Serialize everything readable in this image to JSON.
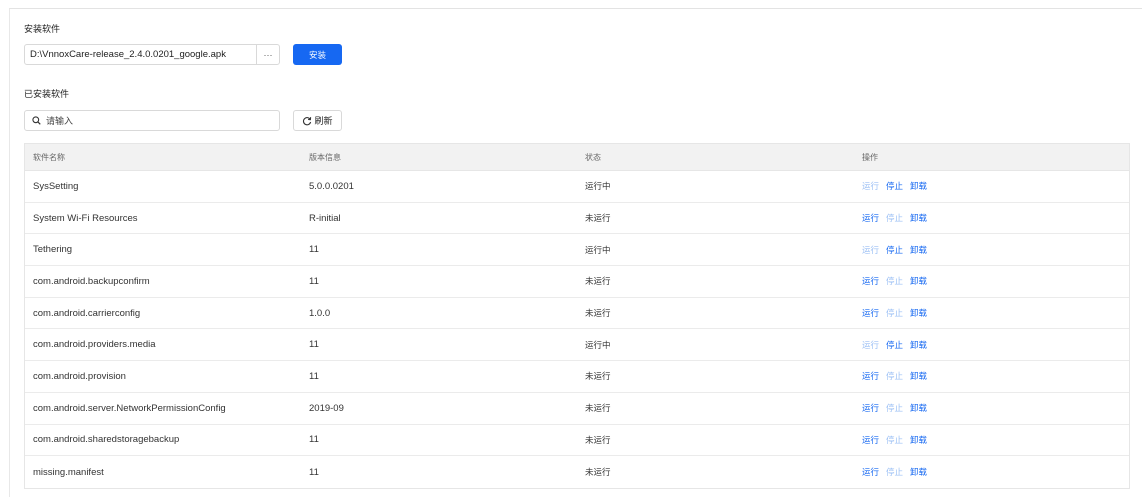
{
  "install": {
    "section_title": "安装软件",
    "file_path": "D:\\VnnoxCare-release_2.4.0.0201_google.apk",
    "browse_label": "···",
    "install_label": "安装"
  },
  "installed": {
    "section_title": "已安装软件",
    "search_placeholder": "请输入",
    "refresh_label": "刷新"
  },
  "table": {
    "headers": [
      "软件名称",
      "版本信息",
      "状态",
      "操作"
    ],
    "rows": [
      {
        "name": "SysSetting",
        "version": "5.0.0.0201",
        "status": "运行中",
        "run": "运行",
        "stop": "停止",
        "uninstall": "卸载"
      },
      {
        "name": "System Wi-Fi Resources",
        "version": "R-initial",
        "status": "未运行",
        "run": "运行",
        "stop": "停止",
        "uninstall": "卸载"
      },
      {
        "name": "Tethering",
        "version": "11",
        "status": "运行中",
        "run": "运行",
        "stop": "停止",
        "uninstall": "卸载"
      },
      {
        "name": "com.android.backupconfirm",
        "version": "11",
        "status": "未运行",
        "run": "运行",
        "stop": "停止",
        "uninstall": "卸载"
      },
      {
        "name": "com.android.carrierconfig",
        "version": "1.0.0",
        "status": "未运行",
        "run": "运行",
        "stop": "停止",
        "uninstall": "卸载"
      },
      {
        "name": "com.android.providers.media",
        "version": "11",
        "status": "运行中",
        "run": "运行",
        "stop": "停止",
        "uninstall": "卸载"
      },
      {
        "name": "com.android.provision",
        "version": "11",
        "status": "未运行",
        "run": "运行",
        "stop": "停止",
        "uninstall": "卸载"
      },
      {
        "name": "com.android.server.NetworkPermissionConfig",
        "version": "2019-09",
        "status": "未运行",
        "run": "运行",
        "stop": "停止",
        "uninstall": "卸载"
      },
      {
        "name": "com.android.sharedstoragebackup",
        "version": "11",
        "status": "未运行",
        "run": "运行",
        "stop": "停止",
        "uninstall": "卸载"
      },
      {
        "name": "missing.manifest",
        "version": "11",
        "status": "未运行",
        "run": "运行",
        "stop": "停止",
        "uninstall": "卸载"
      }
    ]
  },
  "colors": {
    "accent": "#1668f2",
    "accent_disabled": "#9cc0f5",
    "header_bg": "#f2f2f2"
  },
  "icons": {
    "search": "search-icon",
    "refresh": "refresh-icon"
  }
}
